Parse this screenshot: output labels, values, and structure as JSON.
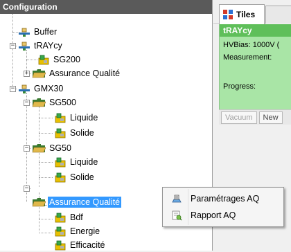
{
  "config": {
    "title": "Configuration",
    "tree": {
      "buffer": "Buffer",
      "traycy": "tRAYcy",
      "sg200": "SG200",
      "assurance_1": "Assurance Qualité",
      "gmx30": "GMX30",
      "sg500": "SG500",
      "liquide_1": "Liquide",
      "solide_1": "Solide",
      "sg50": "SG50",
      "liquide_2": "Liquide",
      "solide_2": "Solide",
      "assurance_2": "Assurance Qualité",
      "bdf": "Bdf",
      "energie": "Energie",
      "efficacite": "Efficacité"
    }
  },
  "tabs": {
    "tiles": "Tiles"
  },
  "tile": {
    "title": "tRAYcy",
    "hvbias": "HVBias: 1000V (",
    "measurement": "Measurement:",
    "progress": "Progress:",
    "vacuum": "Vacuum",
    "new": "New"
  },
  "context_menu": {
    "item1": "Paramétrages AQ",
    "item2": "Rapport AQ"
  },
  "colors": {
    "header_bg": "#5a5a5a",
    "selection": "#3399ff",
    "tile_bg": "#a9e5a6",
    "tile_title_bg": "#5fbf5a"
  }
}
